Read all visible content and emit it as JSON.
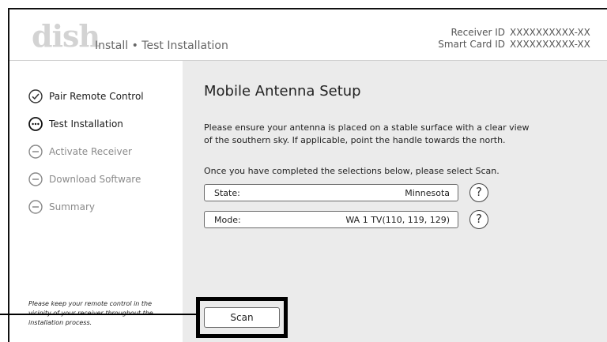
{
  "header": {
    "logo": "dish",
    "breadcrumb": "Install • Test Installation",
    "receiver_id_label": "Receiver ID",
    "receiver_id_value": "XXXXXXXXXX-XX",
    "smart_card_id_label": "Smart Card ID",
    "smart_card_id_value": "XXXXXXXXXX-XX"
  },
  "sidebar": {
    "steps": [
      {
        "label": "Pair Remote Control",
        "state": "done",
        "icon": "check-circle-icon"
      },
      {
        "label": "Test Installation",
        "state": "active",
        "icon": "ellipsis-circle-icon"
      },
      {
        "label": "Activate Receiver",
        "state": "pending",
        "icon": "minus-circle-icon"
      },
      {
        "label": "Download Software",
        "state": "pending",
        "icon": "minus-circle-icon"
      },
      {
        "label": "Summary",
        "state": "pending",
        "icon": "minus-circle-icon"
      }
    ],
    "note": "Please keep your remote control in the vicinity of your receiver throughout the installation process."
  },
  "main": {
    "title": "Mobile Antenna Setup",
    "instructions_line1": "Please ensure your antenna is placed on a stable surface with a clear view",
    "instructions_line2": "of the southern sky.  If applicable, point the handle towards the north.",
    "prompt": "Once you have completed the selections below, please select Scan.",
    "state_label": "State:",
    "state_value": "Minnesota",
    "mode_label": "Mode:",
    "mode_value": "WA 1 TV(110, 119, 129)",
    "help_symbol": "?",
    "scan_label": "Scan"
  },
  "colors": {
    "panel_bg": "#ebebeb",
    "logo": "#d3d3d3",
    "focus_border": "#000000"
  }
}
